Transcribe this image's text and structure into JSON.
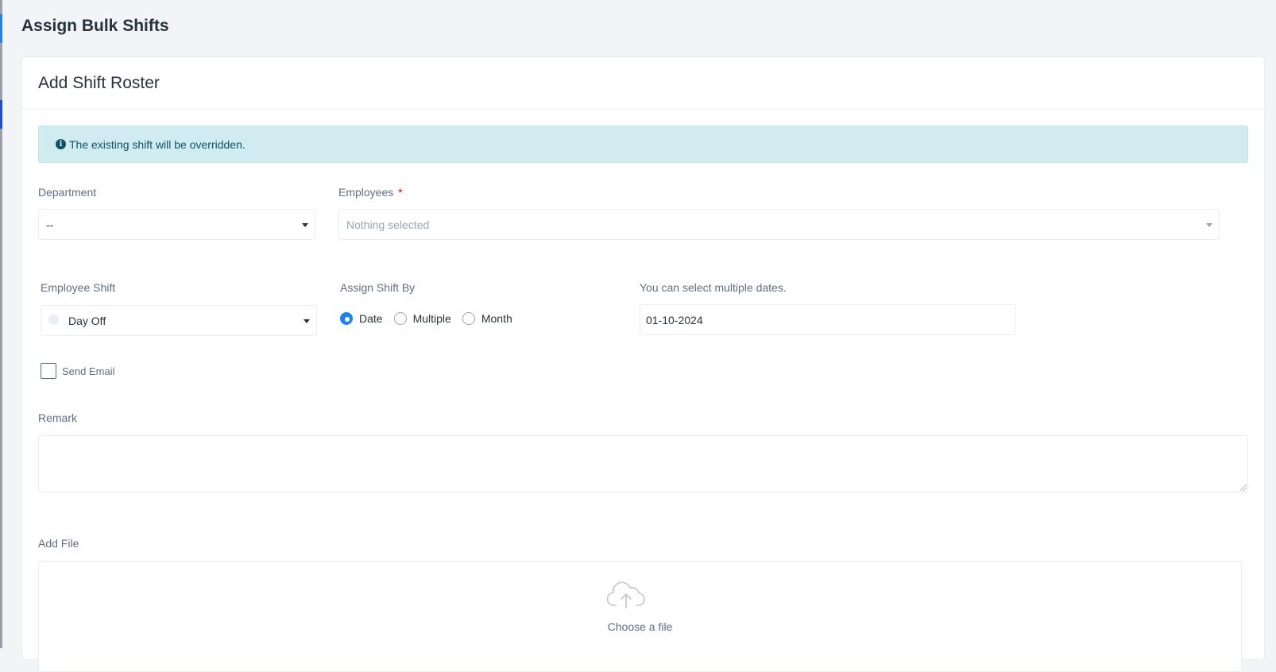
{
  "page": {
    "title": "Assign Bulk Shifts"
  },
  "card": {
    "title": "Add Shift Roster"
  },
  "alert": {
    "icon": "info-circle-icon",
    "message": "The existing shift will be overridden."
  },
  "department": {
    "label": "Department",
    "value": "--"
  },
  "employees": {
    "label": "Employees",
    "required_mark": "*",
    "placeholder": "Nothing selected"
  },
  "employee_shift": {
    "label": "Employee Shift",
    "value": "Day Off"
  },
  "assign_shift_by": {
    "label": "Assign Shift By",
    "options": [
      {
        "label": "Date",
        "checked": true
      },
      {
        "label": "Multiple",
        "checked": false
      },
      {
        "label": "Month",
        "checked": false
      }
    ]
  },
  "dates": {
    "label": "You can select multiple dates.",
    "value": "01-10-2024"
  },
  "send_email": {
    "label": "Send Email",
    "checked": false
  },
  "remark": {
    "label": "Remark",
    "value": ""
  },
  "add_file": {
    "label": "Add File",
    "icon": "cloud-upload-icon",
    "choose_text": "Choose a file"
  },
  "colors": {
    "accent": "#1d82f5",
    "alert_bg": "#d1ecf1",
    "alert_text": "#0c5460",
    "required": "#d30000"
  }
}
